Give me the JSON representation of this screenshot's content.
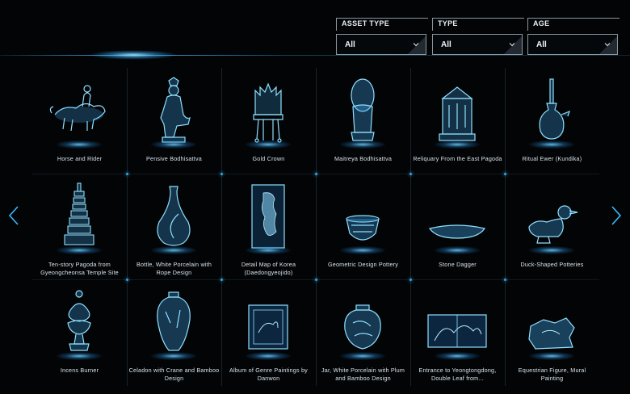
{
  "filters": [
    {
      "label": "ASSET TYPE",
      "value": "All"
    },
    {
      "label": "TYPE",
      "value": "All"
    },
    {
      "label": "AGE",
      "value": "All"
    }
  ],
  "items": [
    {
      "name": "Horse and Rider",
      "icon": "horse-rider-icon"
    },
    {
      "name": "Pensive Bodhisattva",
      "icon": "bodhisattva-statue-icon"
    },
    {
      "name": "Gold Crown",
      "icon": "crown-icon"
    },
    {
      "name": "Maitreya Bodhisattva",
      "icon": "maitreya-statue-icon"
    },
    {
      "name": "Reliquary From the East Pagoda",
      "icon": "reliquary-icon"
    },
    {
      "name": "Ritual Ewer (Kundika)",
      "icon": "ewer-icon"
    },
    {
      "name": "Ten-story Pagoda from Gyeongcheonsa Temple Site",
      "icon": "pagoda-icon"
    },
    {
      "name": "Bottle, White Porcelain with Rope Design",
      "icon": "bottle-icon"
    },
    {
      "name": "Detail Map of Korea (Daedongyeojido)",
      "icon": "map-icon"
    },
    {
      "name": "Geometric Design Pottery",
      "icon": "pottery-icon"
    },
    {
      "name": "Stone Dagger",
      "icon": "dagger-icon"
    },
    {
      "name": "Duck-Shaped Potteries",
      "icon": "duck-vessel-icon"
    },
    {
      "name": "Incens Burner",
      "icon": "incense-burner-icon"
    },
    {
      "name": "Celadon with Crane and Bamboo Design",
      "icon": "celadon-vase-icon"
    },
    {
      "name": "Album of Genre Paintings by Danwon",
      "icon": "album-painting-icon"
    },
    {
      "name": "Jar, White Porcelain with Plum and Bamboo Design",
      "icon": "jar-icon"
    },
    {
      "name": "Entrance to Yeongtongdong, Double Leaf from...",
      "icon": "scroll-painting-icon"
    },
    {
      "name": "Equestrian Figure, Mural Painting",
      "icon": "mural-fragment-icon"
    }
  ],
  "nav": {
    "prev_icon": "chevron-left-icon",
    "next_icon": "chevron-right-icon"
  },
  "colors": {
    "accent": "#3ab8ff",
    "background": "#020406",
    "glow": "#7fd6ff"
  }
}
